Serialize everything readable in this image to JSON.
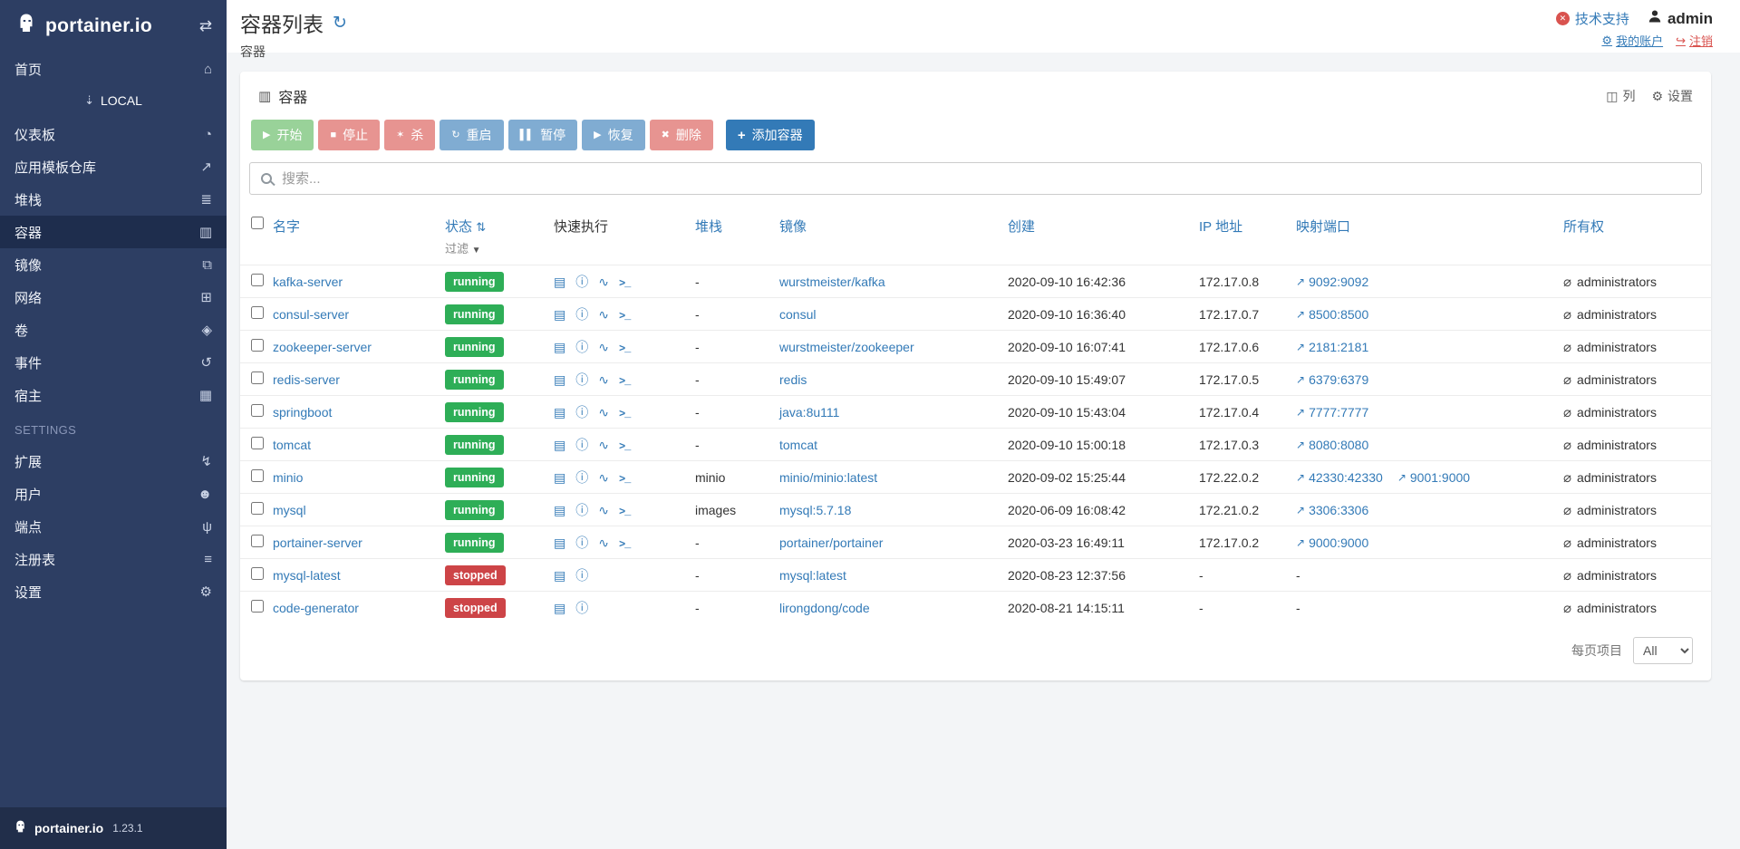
{
  "colors": {
    "sidebar_bg": "#2d3e63",
    "sidebar_active_bg": "#1e2d4d",
    "page_bg": "#f3f5f7",
    "topbar_bg": "#ffffff",
    "link_blue": "#337ab7",
    "running_badge": "#2eae57",
    "stopped_badge": "#cd4447",
    "btn_success": "#5cb85c",
    "btn_danger": "#d9534f",
    "support_red": "#d9534f"
  },
  "sidebar": {
    "logo_text": "portainer.io",
    "collapse_icon": "⇄",
    "home": {
      "label": "首页",
      "icon_glyph": "⌂",
      "icon_name": "home-icon",
      "name": "sidebar-item-home",
      "active": false
    },
    "endpoint": {
      "label": "LOCAL",
      "icon": "⇣"
    },
    "local_items": [
      {
        "label": "仪表板",
        "icon_glyph": "◔",
        "icon_name": "dashboard-icon",
        "name": "sidebar-item-dashboard",
        "active": false
      },
      {
        "label": "应用模板仓库",
        "icon_glyph": "↗",
        "icon_name": "rocket-icon",
        "name": "sidebar-item-app-templates",
        "active": false
      },
      {
        "label": "堆栈",
        "icon_glyph": "≣",
        "icon_name": "stacks-icon",
        "name": "sidebar-item-stacks",
        "active": false
      },
      {
        "label": "容器",
        "icon_glyph": "▥",
        "icon_name": "containers-icon",
        "name": "sidebar-item-containers",
        "active": true
      },
      {
        "label": "镜像",
        "icon_glyph": "⧉",
        "icon_name": "images-icon",
        "name": "sidebar-item-images",
        "active": false
      },
      {
        "label": "网络",
        "icon_glyph": "⊞",
        "icon_name": "networks-icon",
        "name": "sidebar-item-networks",
        "active": false
      },
      {
        "label": "卷",
        "icon_glyph": "◈",
        "icon_name": "volumes-icon",
        "name": "sidebar-item-volumes",
        "active": false
      },
      {
        "label": "事件",
        "icon_glyph": "↺",
        "icon_name": "events-history-icon",
        "name": "sidebar-item-events",
        "active": false
      },
      {
        "label": "宿主",
        "icon_glyph": "▦",
        "icon_name": "host-icon",
        "name": "sidebar-item-host",
        "active": false
      }
    ],
    "settings_label": "SETTINGS",
    "settings_items": [
      {
        "label": "扩展",
        "icon_glyph": "↯",
        "icon_name": "bolt-icon",
        "name": "sidebar-item-extensions",
        "active": false
      },
      {
        "label": "用户",
        "icon_glyph": "☻",
        "icon_name": "users-icon",
        "name": "sidebar-item-users",
        "active": false
      },
      {
        "label": "端点",
        "icon_glyph": "ψ",
        "icon_name": "plug-icon",
        "name": "sidebar-item-endpoints",
        "active": false
      },
      {
        "label": "注册表",
        "icon_glyph": "≡",
        "icon_name": "registries-icon",
        "name": "sidebar-item-registries",
        "active": false
      },
      {
        "label": "设置",
        "icon_glyph": "⚙",
        "icon_name": "gear-icon",
        "name": "sidebar-item-settings",
        "active": false
      }
    ],
    "footer": {
      "brand": "portainer.io",
      "version": "1.23.1"
    }
  },
  "topbar": {
    "title": "容器列表",
    "refresh_icon": "↻",
    "breadcrumb": "容器",
    "support": {
      "label": "技术支持",
      "icon_glyph": "✕"
    },
    "user": {
      "name": "admin"
    },
    "my_account": {
      "label": "我的账户",
      "icon_glyph": "⚙"
    },
    "logout": {
      "label": "注销",
      "icon_glyph": "↪"
    }
  },
  "panel": {
    "title": "容器",
    "title_icon": "▥",
    "columns_button": "列",
    "columns_icon": "◫",
    "settings_button": "设置",
    "settings_icon": "⚙",
    "search_placeholder": "搜索...",
    "toolbar": {
      "buttons": [
        {
          "label": "开始",
          "icon_glyph": "▶",
          "icon_name": "play-icon",
          "style": "success",
          "name": "start-button",
          "disabled": true
        },
        {
          "label": "停止",
          "icon_glyph": "■",
          "icon_name": "stop-icon",
          "style": "danger",
          "name": "stop-button",
          "disabled": true
        },
        {
          "label": "杀",
          "icon_glyph": "✶",
          "icon_name": "bomb-icon",
          "style": "danger",
          "name": "kill-button",
          "disabled": true
        },
        {
          "label": "重启",
          "icon_glyph": "↻",
          "icon_name": "restart-icon",
          "style": "primary",
          "name": "restart-button",
          "disabled": true
        },
        {
          "label": "暂停",
          "icon_glyph": "▌▌",
          "icon_name": "pause-icon",
          "style": "primary",
          "name": "pause-button",
          "disabled": true
        },
        {
          "label": "恢复",
          "icon_glyph": "▶",
          "icon_name": "resume-icon",
          "style": "primary",
          "name": "resume-button",
          "disabled": true
        },
        {
          "label": "删除",
          "icon_glyph": "✖",
          "icon_name": "trash-icon",
          "style": "danger",
          "name": "remove-button",
          "disabled": true
        }
      ],
      "add_button": {
        "label": "添加容器",
        "icon_glyph": "+",
        "icon_name": "plus-icon",
        "name": "add-container-button"
      }
    },
    "quick_action_icons": {
      "logs": {
        "glyph": "▤",
        "name": "logs-icon"
      },
      "inspect": {
        "glyph": "ⓘ",
        "name": "inspect-icon"
      },
      "stats": {
        "glyph": "∿",
        "name": "stats-icon"
      },
      "console": {
        "glyph": ">_",
        "name": "console-icon"
      }
    },
    "external_link_icon": {
      "glyph": "↗",
      "name": "external-link-icon"
    },
    "ownership_icon": {
      "glyph": "⌀",
      "name": "eye-slash-icon"
    },
    "table": {
      "sort_icon": "⇅",
      "filter_icon": "▼",
      "empty_value": "-",
      "headers": {
        "name": "名字",
        "state": "状态",
        "filter": "过滤",
        "quick_actions": "快速执行",
        "stack": "堆栈",
        "image": "镜像",
        "created": "创建",
        "ip": "IP 地址",
        "ports": "映射端口",
        "ownership": "所有权"
      },
      "rows": [
        {
          "name": "kafka-server",
          "state": "running",
          "state_type": "running",
          "quick_actions": [
            "logs",
            "inspect",
            "stats",
            "console"
          ],
          "stack": "-",
          "image": "wurstmeister/kafka",
          "created": "2020-09-10 16:42:36",
          "ip": "172.17.0.8",
          "ports": [
            "9092:9092"
          ],
          "ownership": "administrators"
        },
        {
          "name": "consul-server",
          "state": "running",
          "state_type": "running",
          "quick_actions": [
            "logs",
            "inspect",
            "stats",
            "console"
          ],
          "stack": "-",
          "image": "consul",
          "created": "2020-09-10 16:36:40",
          "ip": "172.17.0.7",
          "ports": [
            "8500:8500"
          ],
          "ownership": "administrators"
        },
        {
          "name": "zookeeper-server",
          "state": "running",
          "state_type": "running",
          "quick_actions": [
            "logs",
            "inspect",
            "stats",
            "console"
          ],
          "stack": "-",
          "image": "wurstmeister/zookeeper",
          "created": "2020-09-10 16:07:41",
          "ip": "172.17.0.6",
          "ports": [
            "2181:2181"
          ],
          "ownership": "administrators"
        },
        {
          "name": "redis-server",
          "state": "running",
          "state_type": "running",
          "quick_actions": [
            "logs",
            "inspect",
            "stats",
            "console"
          ],
          "stack": "-",
          "image": "redis",
          "created": "2020-09-10 15:49:07",
          "ip": "172.17.0.5",
          "ports": [
            "6379:6379"
          ],
          "ownership": "administrators"
        },
        {
          "name": "springboot",
          "state": "running",
          "state_type": "running",
          "quick_actions": [
            "logs",
            "inspect",
            "stats",
            "console"
          ],
          "stack": "-",
          "image": "java:8u111",
          "created": "2020-09-10 15:43:04",
          "ip": "172.17.0.4",
          "ports": [
            "7777:7777"
          ],
          "ownership": "administrators"
        },
        {
          "name": "tomcat",
          "state": "running",
          "state_type": "running",
          "quick_actions": [
            "logs",
            "inspect",
            "stats",
            "console"
          ],
          "stack": "-",
          "image": "tomcat",
          "created": "2020-09-10 15:00:18",
          "ip": "172.17.0.3",
          "ports": [
            "8080:8080"
          ],
          "ownership": "administrators"
        },
        {
          "name": "minio",
          "state": "running",
          "state_type": "running",
          "quick_actions": [
            "logs",
            "inspect",
            "stats",
            "console"
          ],
          "stack": "minio",
          "image": "minio/minio:latest",
          "created": "2020-09-02 15:25:44",
          "ip": "172.22.0.2",
          "ports": [
            "42330:42330",
            "9001:9000"
          ],
          "ownership": "administrators"
        },
        {
          "name": "mysql",
          "state": "running",
          "state_type": "running",
          "quick_actions": [
            "logs",
            "inspect",
            "stats",
            "console"
          ],
          "stack": "images",
          "image": "mysql:5.7.18",
          "created": "2020-06-09 16:08:42",
          "ip": "172.21.0.2",
          "ports": [
            "3306:3306"
          ],
          "ownership": "administrators"
        },
        {
          "name": "portainer-server",
          "state": "running",
          "state_type": "running",
          "quick_actions": [
            "logs",
            "inspect",
            "stats",
            "console"
          ],
          "stack": "-",
          "image": "portainer/portainer",
          "created": "2020-03-23 16:49:11",
          "ip": "172.17.0.2",
          "ports": [
            "9000:9000"
          ],
          "ownership": "administrators"
        },
        {
          "name": "mysql-latest",
          "state": "stopped",
          "state_type": "stopped",
          "quick_actions": [
            "logs",
            "inspect"
          ],
          "stack": "-",
          "image": "mysql:latest",
          "created": "2020-08-23 12:37:56",
          "ip": "-",
          "ports": [],
          "ownership": "administrators"
        },
        {
          "name": "code-generator",
          "state": "stopped",
          "state_type": "stopped",
          "quick_actions": [
            "logs",
            "inspect"
          ],
          "stack": "-",
          "image": "lirongdong/code",
          "created": "2020-08-21 14:15:11",
          "ip": "-",
          "ports": [],
          "ownership": "administrators"
        }
      ]
    },
    "pagination": {
      "label": "每页项目",
      "selected": "All",
      "options": [
        "All"
      ]
    }
  }
}
